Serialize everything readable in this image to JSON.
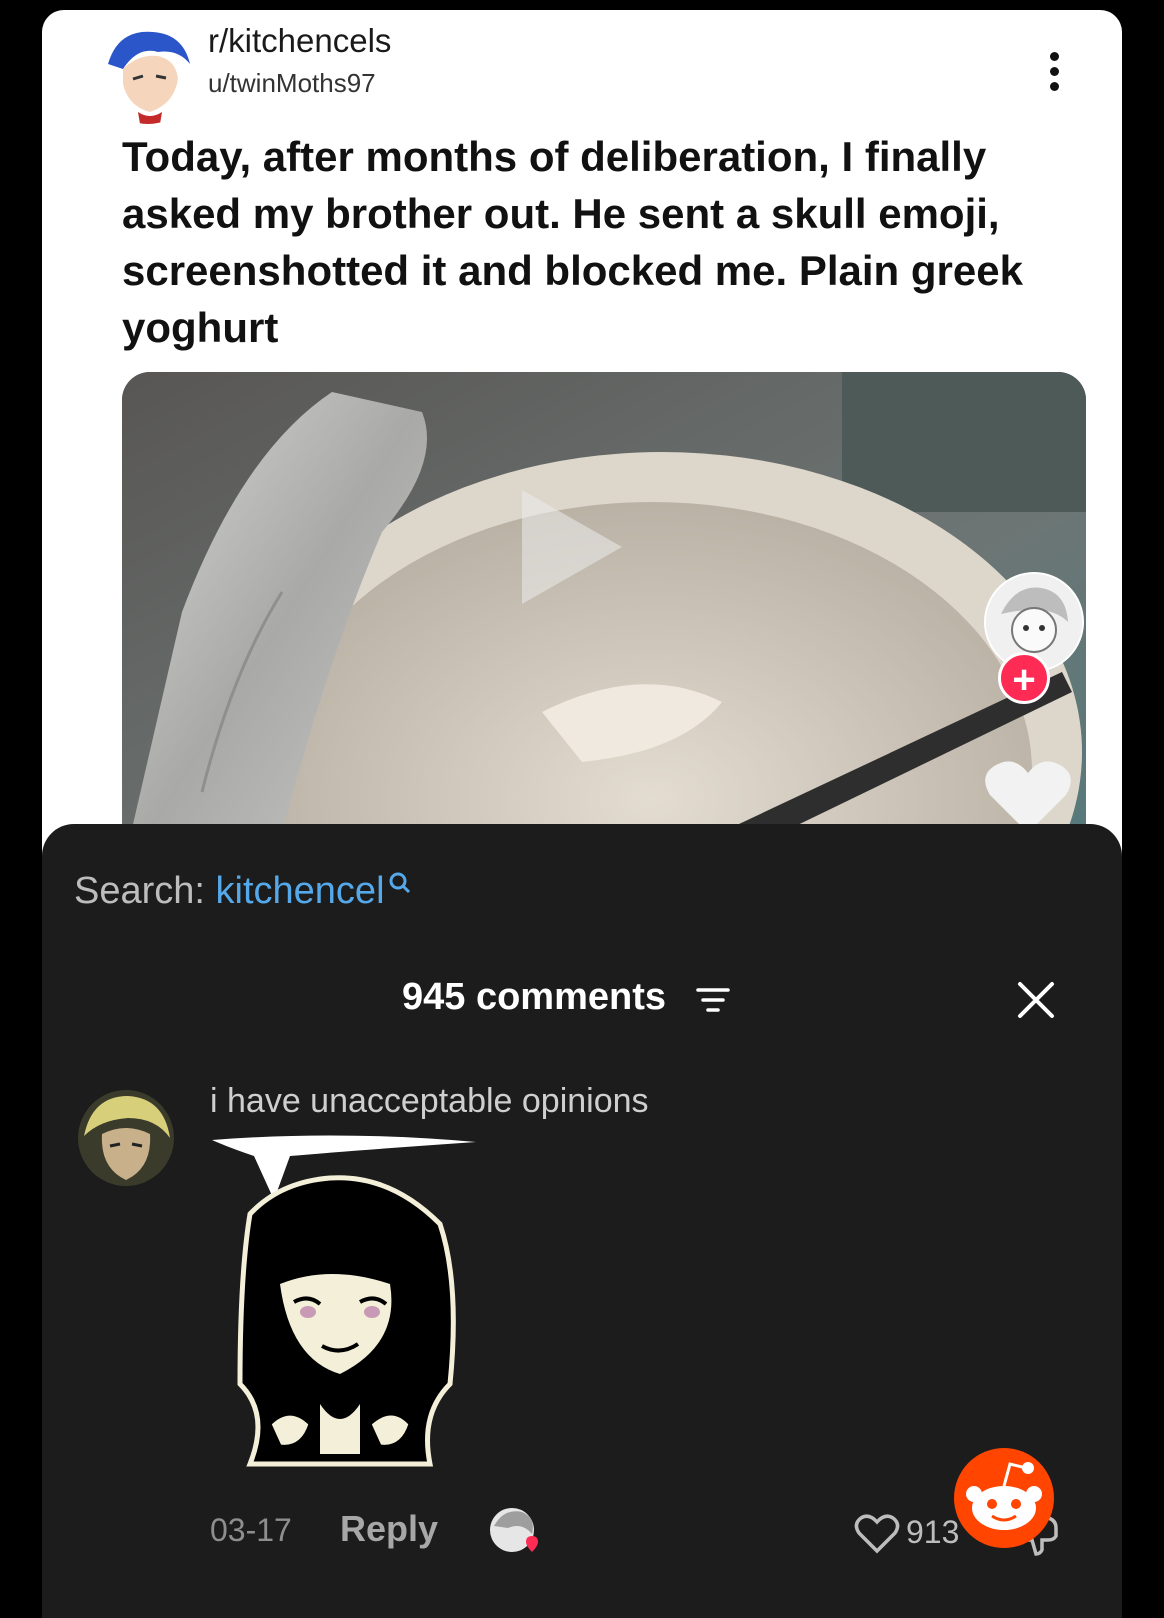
{
  "post": {
    "subreddit": "r/kitchencels",
    "username": "u/twinMoths97",
    "title": "Today, after months of deliberation, I finally asked my brother out. He sent a skull emoji, screenshotted it and blocked me. Plain greek yoghurt"
  },
  "video_overlay": {
    "follow_symbol": "+"
  },
  "comments_panel": {
    "search_label": "Search:",
    "search_term": "kitchencel",
    "count_label": "945 comments"
  },
  "comment": {
    "text": "i have unacceptable opinions",
    "date": "03-17",
    "reply_label": "Reply",
    "likes": "913"
  },
  "icons": {
    "more": "more-vertical-icon",
    "play": "play-icon",
    "heart": "heart-icon",
    "search": "search-icon",
    "filter": "filter-icon",
    "close": "close-icon",
    "dislike": "dislike-icon",
    "logo": "reddit-logo"
  },
  "colors": {
    "accent_link": "#55a8e9",
    "follow_red": "#fe2c55",
    "reddit_orange": "#ff4500",
    "panel_bg": "#1c1c1c"
  }
}
